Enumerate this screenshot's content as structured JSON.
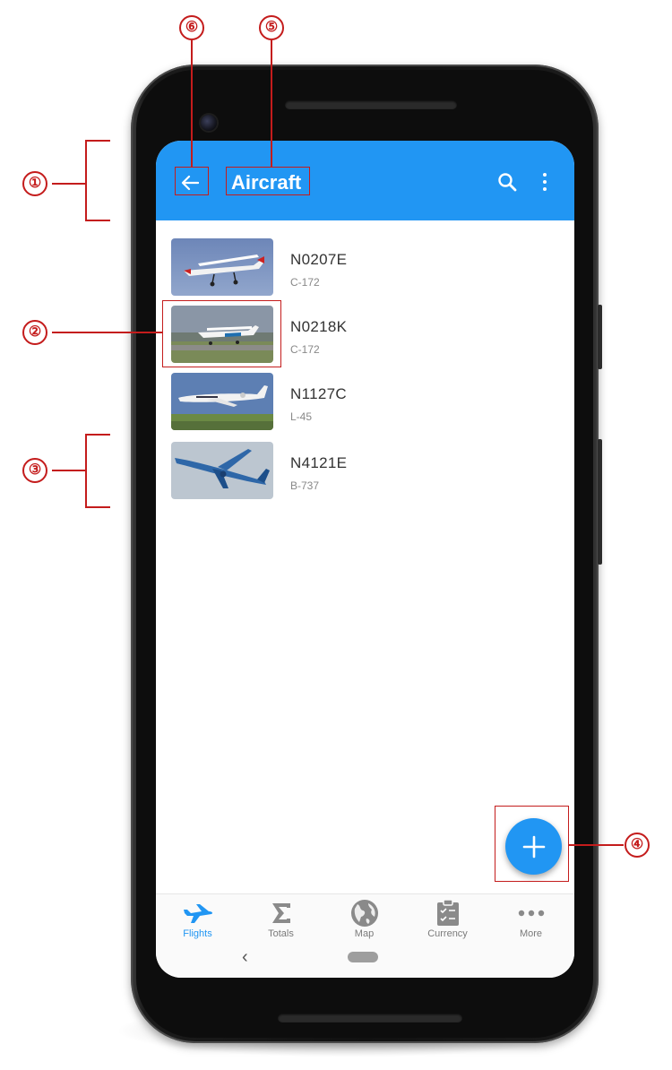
{
  "app_bar": {
    "title": "Aircraft",
    "back_icon": "arrow-left-icon",
    "search_icon": "search-icon",
    "overflow_icon": "more-vert-icon",
    "color": "#2196f3"
  },
  "aircraft": [
    {
      "tail": "N0207E",
      "model": "C-172",
      "photo": "cessna-photo"
    },
    {
      "tail": "N0218K",
      "model": "C-172",
      "photo": "cessna-photo"
    },
    {
      "tail": "N1127C",
      "model": "L-45",
      "photo": "learjet-photo"
    },
    {
      "tail": "N4121E",
      "model": "B-737",
      "photo": "boeing-photo"
    }
  ],
  "fab": {
    "icon": "plus-icon"
  },
  "bottom_nav": {
    "items": [
      {
        "label": "Flights",
        "icon": "airplane-icon",
        "active": true
      },
      {
        "label": "Totals",
        "icon": "sigma-icon",
        "active": false
      },
      {
        "label": "Map",
        "icon": "globe-icon",
        "active": false
      },
      {
        "label": "Currency",
        "icon": "clipboard-check-icon",
        "active": false
      },
      {
        "label": "More",
        "icon": "more-horiz-icon",
        "active": false
      }
    ]
  },
  "callouts": [
    "①",
    "②",
    "③",
    "④",
    "⑤",
    "⑥"
  ],
  "colors": {
    "accent": "#2196f3",
    "annotation": "#c41c1c"
  }
}
